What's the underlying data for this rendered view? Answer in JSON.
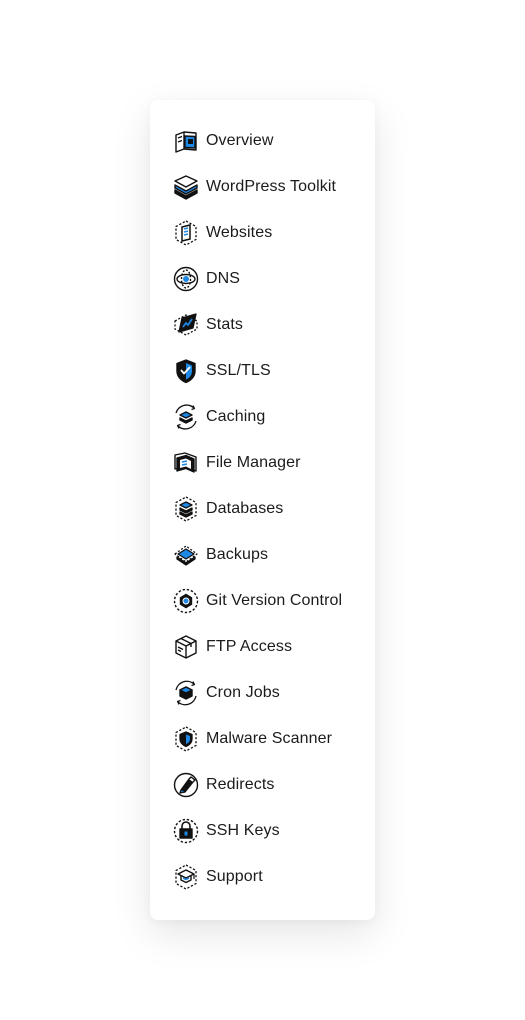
{
  "colors": {
    "accent": "#1e88e5",
    "ink": "#111111",
    "card_background": "#ffffff"
  },
  "menu": {
    "items": [
      {
        "label": "Overview",
        "icon": "overview-icon"
      },
      {
        "label": "WordPress Toolkit",
        "icon": "wordpress-toolkit-icon"
      },
      {
        "label": "Websites",
        "icon": "websites-icon"
      },
      {
        "label": "DNS",
        "icon": "dns-icon"
      },
      {
        "label": "Stats",
        "icon": "stats-icon"
      },
      {
        "label": "SSL/TLS",
        "icon": "ssl-shield-icon"
      },
      {
        "label": "Caching",
        "icon": "caching-icon"
      },
      {
        "label": "File Manager",
        "icon": "file-manager-icon"
      },
      {
        "label": "Databases",
        "icon": "databases-icon"
      },
      {
        "label": "Backups",
        "icon": "backups-icon"
      },
      {
        "label": "Git Version Control",
        "icon": "git-icon"
      },
      {
        "label": "FTP Access",
        "icon": "ftp-box-icon"
      },
      {
        "label": "Cron Jobs",
        "icon": "cron-jobs-icon"
      },
      {
        "label": "Malware Scanner",
        "icon": "malware-scanner-icon"
      },
      {
        "label": "Redirects",
        "icon": "redirects-icon"
      },
      {
        "label": "SSH Keys",
        "icon": "ssh-key-icon"
      },
      {
        "label": "Support",
        "icon": "support-icon"
      }
    ]
  }
}
